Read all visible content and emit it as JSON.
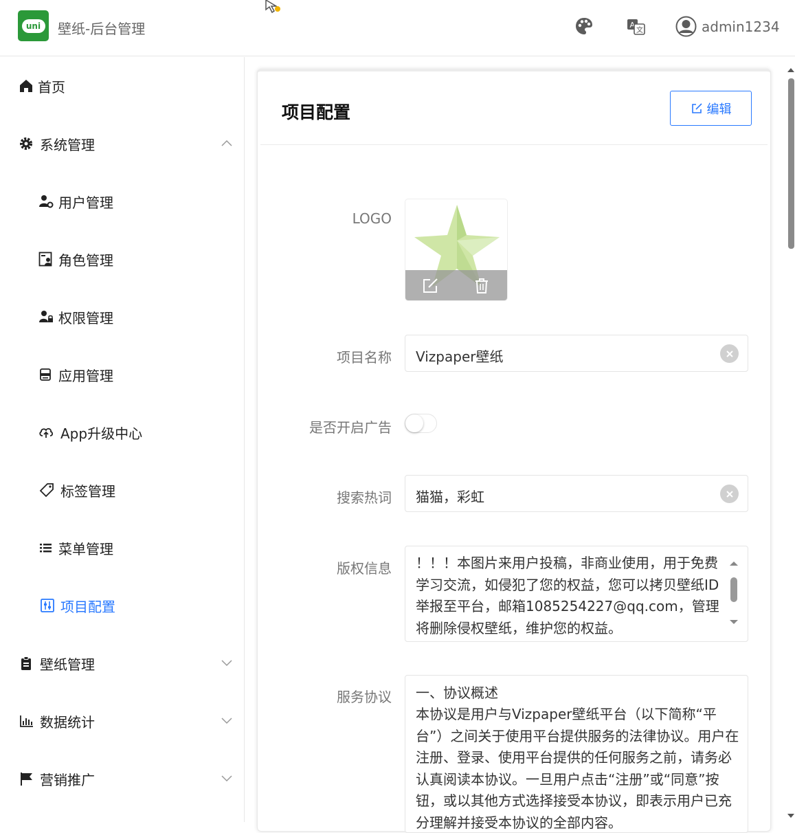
{
  "header": {
    "logo_text": "uni",
    "title": "壁纸-后台管理",
    "user_name": "admin1234",
    "icons": [
      "cursor-icon",
      "palette-icon",
      "translate-icon",
      "user-avatar-icon"
    ]
  },
  "sidebar": {
    "items": [
      {
        "label": "首页",
        "icon": "home-icon"
      },
      {
        "label": "系统管理",
        "icon": "gear-icon",
        "expanded": true
      },
      {
        "label": "用户管理",
        "icon": "user-gear-icon"
      },
      {
        "label": "角色管理",
        "icon": "role-icon"
      },
      {
        "label": "权限管理",
        "icon": "permission-icon"
      },
      {
        "label": "应用管理",
        "icon": "app-icon"
      },
      {
        "label": "App升级中心",
        "icon": "cloud-upload-icon"
      },
      {
        "label": "标签管理",
        "icon": "tag-icon"
      },
      {
        "label": "菜单管理",
        "icon": "list-icon"
      },
      {
        "label": "项目配置",
        "icon": "config-icon",
        "active": true
      },
      {
        "label": "壁纸管理",
        "icon": "clipboard-icon",
        "expanded": false
      },
      {
        "label": "数据统计",
        "icon": "bar-chart-icon",
        "expanded": false
      },
      {
        "label": "营销推广",
        "icon": "flag-icon",
        "expanded": false
      }
    ]
  },
  "main": {
    "title": "项目配置",
    "edit_label": "编辑",
    "form": {
      "logo_label": "LOGO",
      "name_label": "项目名称",
      "name_value": "Vizpaper壁纸",
      "ad_label": "是否开启广告",
      "ad_enabled": false,
      "keywords_label": "搜索热词",
      "keywords_value": "猫猫，彩虹",
      "copyright_label": "版权信息",
      "copyright_value": "！！！本图片来用户投稿，非商业使用，用于免费学习交流，如侵犯了您的权益，您可以拷贝壁纸ID举报至平台，邮箱1085254227@qq.com，管理将删除侵权壁纸，维护您的权益。",
      "agreement_label": "服务协议",
      "agreement_heading": "一、协议概述",
      "agreement_value": "本协议是用户与Vizpaper壁纸平台（以下简称“平台”）之间关于使用平台提供服务的法律协议。用户在注册、登录、使用平台提供的任何服务之前，请务必认真阅读本协议。一旦用户点击“注册”或“同意”按钮，或以其他方式选择接受本协议，即表示用户已充分理解并接受本协议的全部内容。"
    }
  },
  "colors": {
    "brand_green": "#2b9939",
    "accent_blue": "#2979ff"
  }
}
